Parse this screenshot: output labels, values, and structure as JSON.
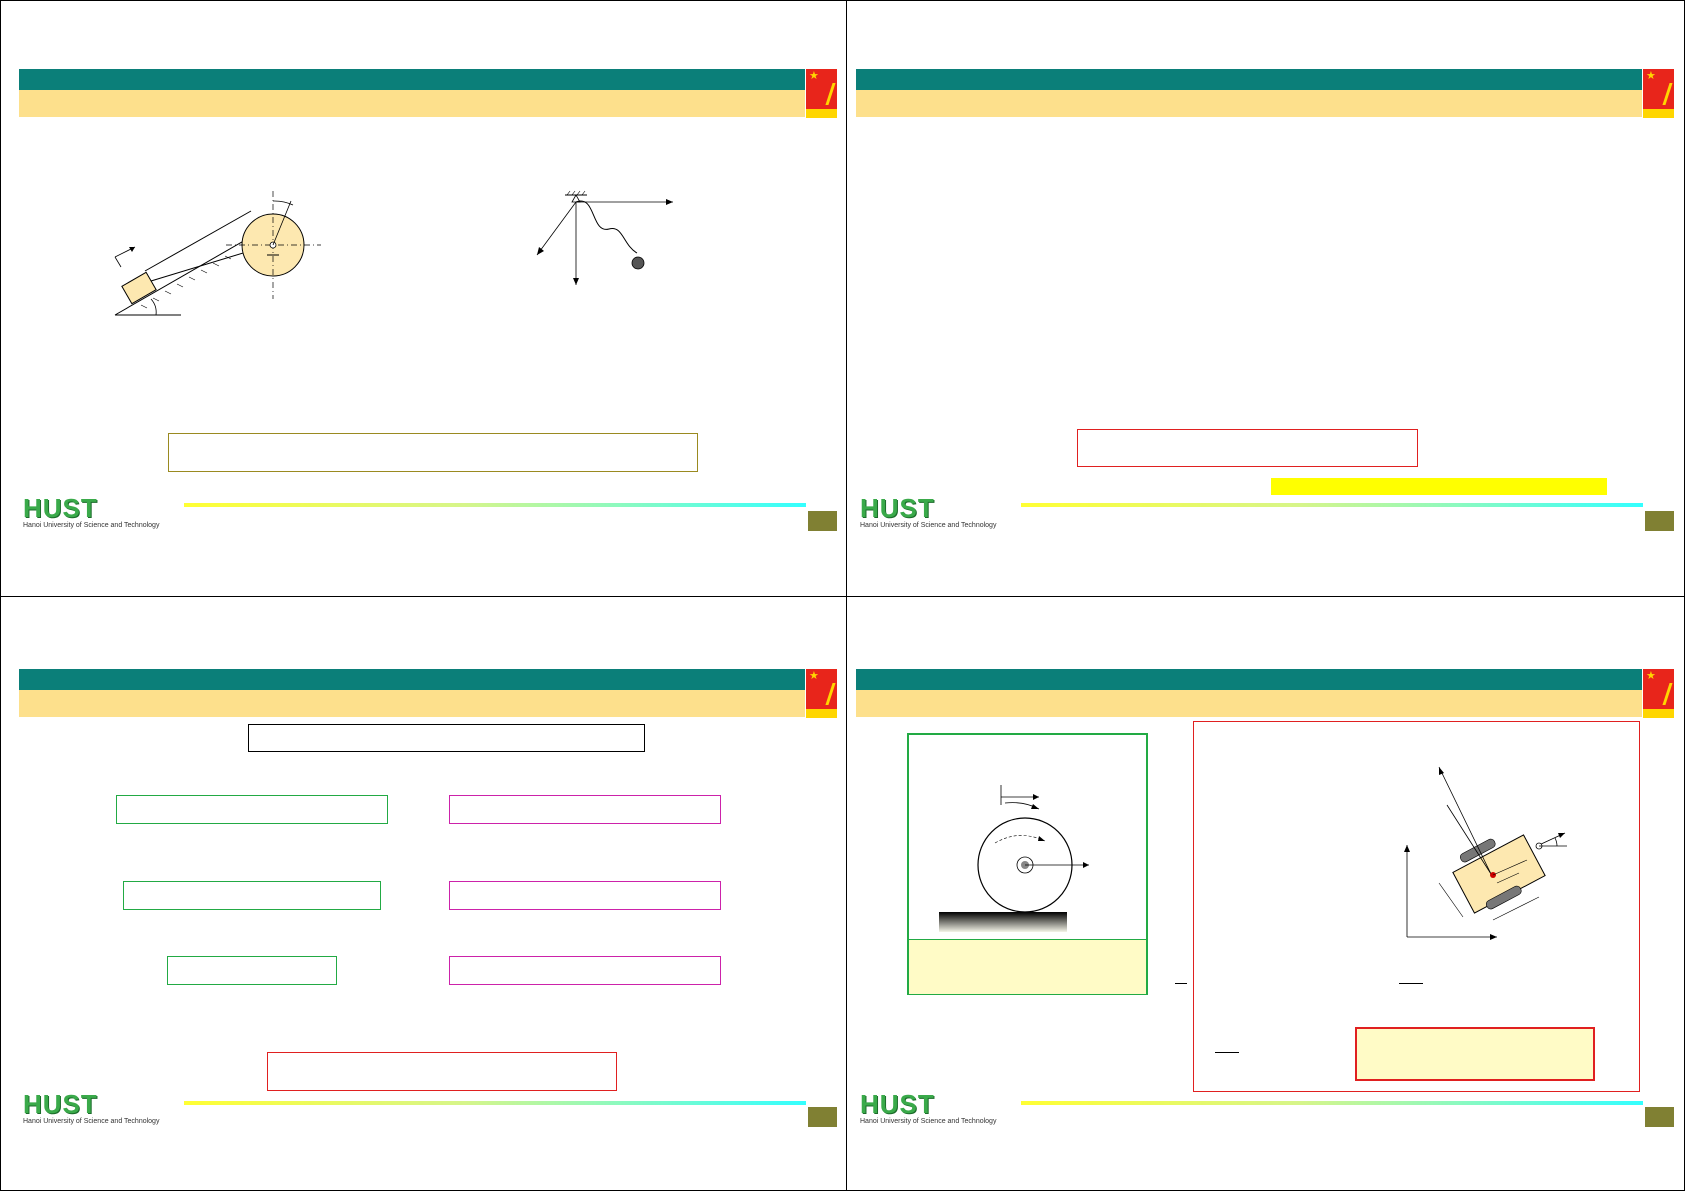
{
  "slides": [
    {
      "id": "slide-1",
      "footer": {
        "logo_text": "HUST",
        "logo_subtitle": "Hanoi University of Science and Technology"
      }
    },
    {
      "id": "slide-2",
      "footer": {
        "logo_text": "HUST",
        "logo_subtitle": "Hanoi University of Science and Technology"
      }
    },
    {
      "id": "slide-3",
      "footer": {
        "logo_text": "HUST",
        "logo_subtitle": "Hanoi University of Science and Technology"
      }
    },
    {
      "id": "slide-4",
      "footer": {
        "logo_text": "HUST",
        "logo_subtitle": "Hanoi University of Science and Technology"
      }
    }
  ],
  "colors": {
    "title_bar": "#0b7f79",
    "subtitle_bar": "#fde08c",
    "page_number_box": "#808033",
    "highlight_yellow": "#ffff00",
    "box_red": "#e02020",
    "box_green": "#22aa44",
    "box_magenta": "#cc22aa",
    "box_olive": "#9a8a20"
  },
  "icons": [
    "university-crest-icon",
    "hust-logo"
  ]
}
